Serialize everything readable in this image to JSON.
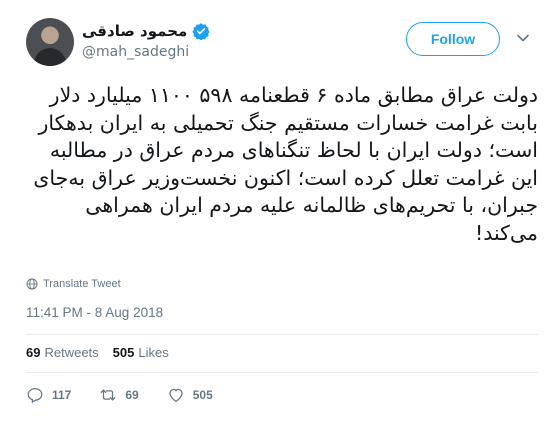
{
  "author": {
    "display_name": "محمود صادقی",
    "handle": "@mah_sadeghi"
  },
  "follow_label": "Follow",
  "tweet": {
    "text": "دولت عراق مطابق ماده ۶ قطعنامه ۵۹۸ ۱۱۰۰ میلیارد دلار بابت غرامت خسارات مستقیم جنگ تحمیلی به ایران بدهکار است؛ دولت ایران با لحاظ تنگناهای مردم عراق در مطالبه این غرامت تعلل کرده است؛ اکنون نخست‌وزیر عراق به‌جای جبران، با تحریم‌های ظالمانه علیه مردم ایران همراهی می‌کند!",
    "translate_label": "Translate Tweet",
    "timestamp": "11:41 PM - 8 Aug 2018"
  },
  "stats": {
    "retweets_count": "69",
    "retweets_label": "Retweets",
    "likes_count": "505",
    "likes_label": "Likes"
  },
  "actions": {
    "reply_count": "117",
    "retweet_count": "69",
    "like_count": "505"
  },
  "colors": {
    "accent": "#1da1f2",
    "muted": "#657786",
    "divider": "#e6ecf0"
  }
}
